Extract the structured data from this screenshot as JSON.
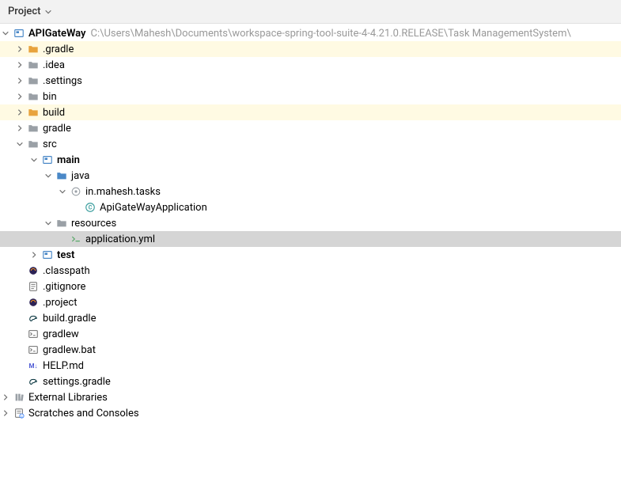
{
  "header": {
    "title": "Project"
  },
  "project": {
    "name": "APIGateWay",
    "path": "C:\\Users\\Mahesh\\Documents\\workspace-spring-tool-suite-4-4.21.0.RELEASE\\Task ManagementSystem\\"
  },
  "nodes": {
    "gradle_dot": ".gradle",
    "idea": ".idea",
    "settings": ".settings",
    "bin": "bin",
    "build": "build",
    "gradle": "gradle",
    "src": "src",
    "main": "main",
    "java": "java",
    "pkg": "in.mahesh.tasks",
    "app_class": "ApiGateWayApplication",
    "resources": "resources",
    "app_yml": "application.yml",
    "test": "test",
    "classpath": ".classpath",
    "gitignore": ".gitignore",
    "project_file": ".project",
    "build_gradle": "build.gradle",
    "gradlew": "gradlew",
    "gradlew_bat": "gradlew.bat",
    "help_md": "HELP.md",
    "settings_gradle": "settings.gradle",
    "ext_libs": "External Libraries",
    "scratches": "Scratches and Consoles"
  },
  "colors": {
    "folder_orange": "#e8a33d",
    "folder_gray": "#9aa0a6",
    "folder_blue": "#4a88c7",
    "icon_green": "#59a869",
    "icon_teal": "#3b9e9e",
    "icon_purple": "#4f5bd5",
    "text_muted": "#999"
  }
}
